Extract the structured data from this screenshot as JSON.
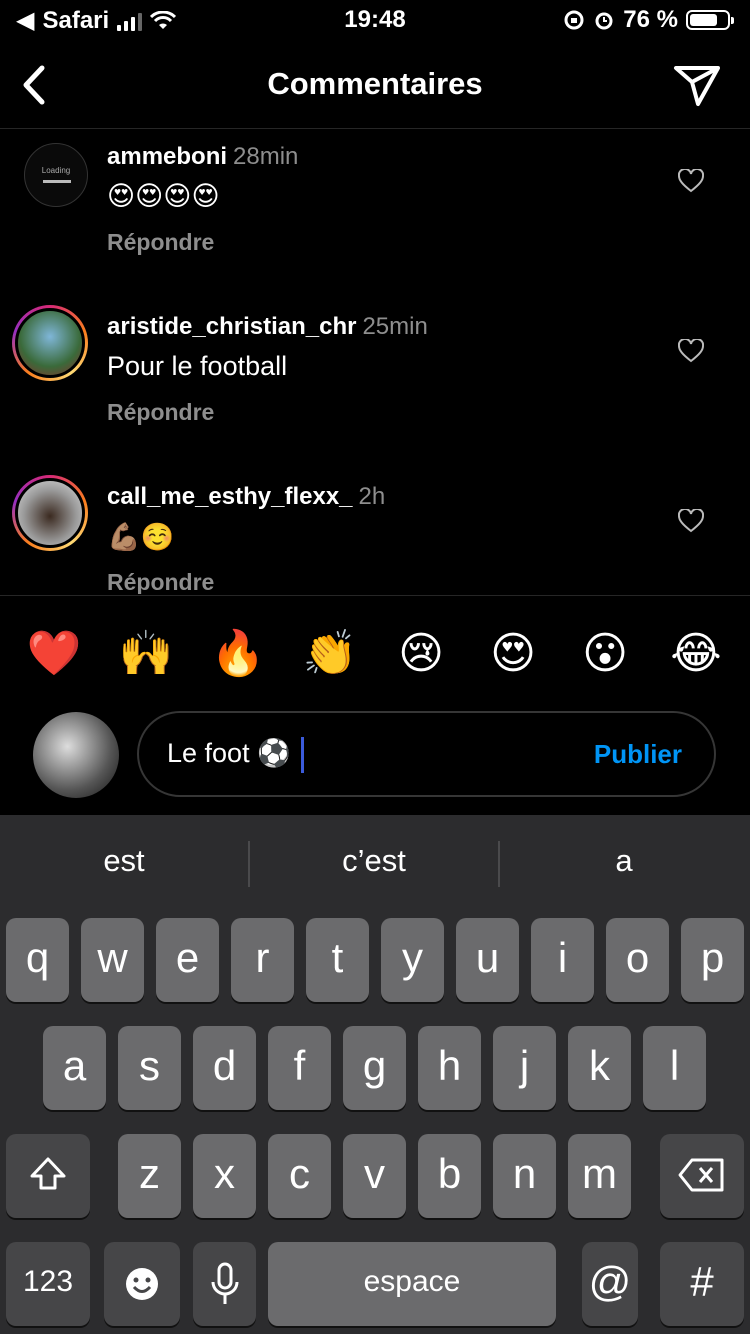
{
  "status_bar": {
    "back_app": "Safari",
    "time": "19:48",
    "battery": "76 %",
    "battery_level": 0.76
  },
  "header": {
    "title": "Commentaires"
  },
  "comments": [
    {
      "user": "ammeboni",
      "time": "28min",
      "text": "😍😍😍😍",
      "reply": "Répondre",
      "avatar_placeholder": "Loading"
    },
    {
      "user": "aristide_christian_chr",
      "time": "25min",
      "text": "Pour le football",
      "reply": "Répondre"
    },
    {
      "user": "call_me_esthy_flexx_",
      "time": "2h",
      "text": "💪🏽☺️",
      "reply": "Répondre"
    }
  ],
  "reactions": [
    "❤️",
    "🙌",
    "🔥",
    "👏",
    "😢",
    "😍",
    "😮",
    "😂"
  ],
  "composer": {
    "input_value": "Le foot ⚽️",
    "publish_label": "Publier"
  },
  "keyboard": {
    "suggestions": [
      "est",
      "c’est",
      "a"
    ],
    "row1": [
      "q",
      "w",
      "e",
      "r",
      "t",
      "y",
      "u",
      "i",
      "o",
      "p"
    ],
    "row2": [
      "a",
      "s",
      "d",
      "f",
      "g",
      "h",
      "j",
      "k",
      "l"
    ],
    "row3": [
      "z",
      "x",
      "c",
      "v",
      "b",
      "n",
      "m"
    ],
    "numbers_label": "123",
    "space_label": "espace",
    "at_label": "@",
    "hash_label": "#"
  }
}
